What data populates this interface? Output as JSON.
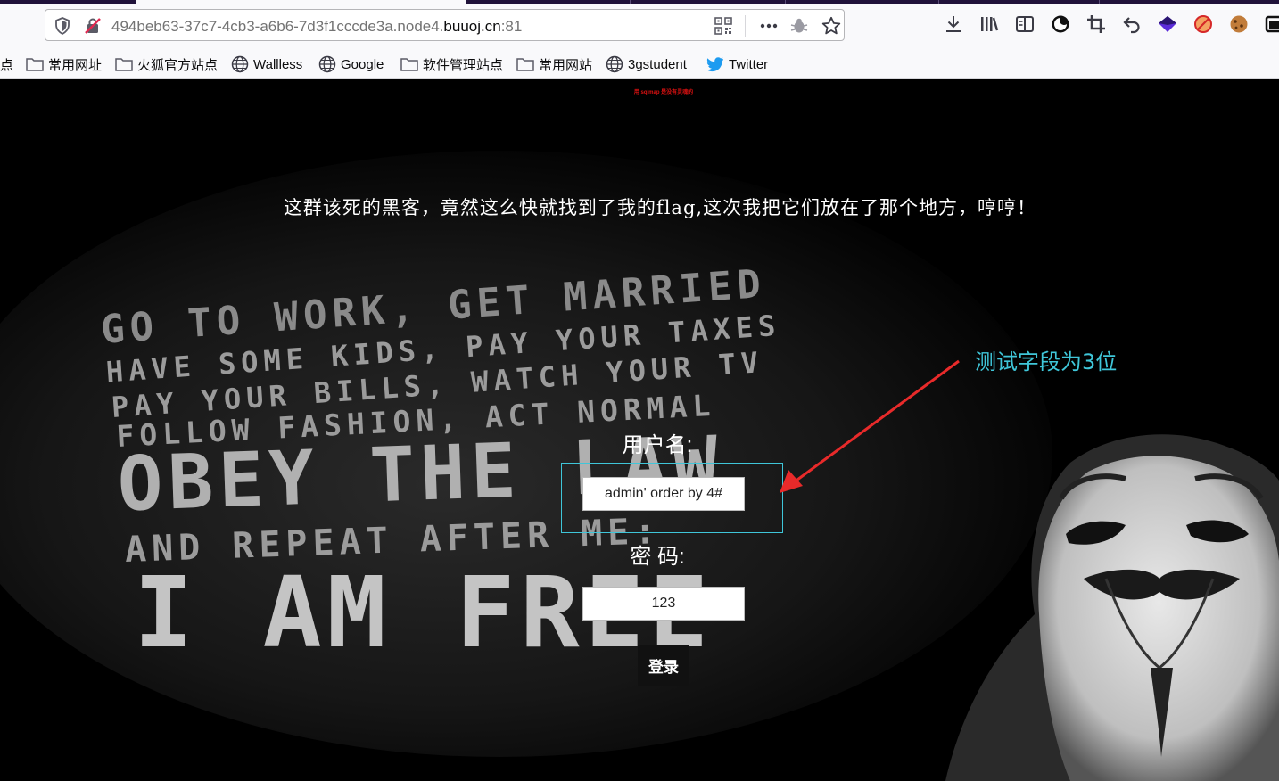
{
  "browser": {
    "url": {
      "prefix": "494beb63-37c7-4cb3-a6b6-7d3f1cccde3a.node4.",
      "domain": "buuoj.cn",
      "port": ":81"
    },
    "bookmarks": [
      {
        "label": "点",
        "icon": "folder-icon"
      },
      {
        "label": "常用网址",
        "icon": "folder-icon"
      },
      {
        "label": "火狐官方站点",
        "icon": "folder-icon"
      },
      {
        "label": "Wallless",
        "icon": "globe-icon"
      },
      {
        "label": "Google",
        "icon": "globe-icon"
      },
      {
        "label": "软件管理站点",
        "icon": "folder-icon"
      },
      {
        "label": "常用网站",
        "icon": "folder-icon"
      },
      {
        "label": "3gstudent",
        "icon": "globe-icon"
      },
      {
        "label": "Twitter",
        "icon": "twitter-icon"
      }
    ]
  },
  "page": {
    "top_note": "用 sqlmap 是没有灵魂的",
    "headline": "这群该死的黑客，竟然这么快就找到了我的flag,这次我把它们放在了那个地方，哼哼！",
    "background_text": [
      "GO TO WORK, GET MARRIED",
      "HAVE SOME KIDS, PAY YOUR TAXES",
      "PAY YOUR BILLS, WATCH YOUR TV",
      "FOLLOW FASHION, ACT NORMAL",
      "OBEY THE LAW",
      "AND REPEAT AFTER ME:",
      "I AM FREE"
    ],
    "form": {
      "username_label": "用户名:",
      "username_value": "admin' order by 4#",
      "password_label": "密 码:",
      "password_value": "123",
      "login_label": "登录"
    },
    "annotation": {
      "text": "测试字段为3位",
      "color": "#3fc6d9"
    }
  }
}
